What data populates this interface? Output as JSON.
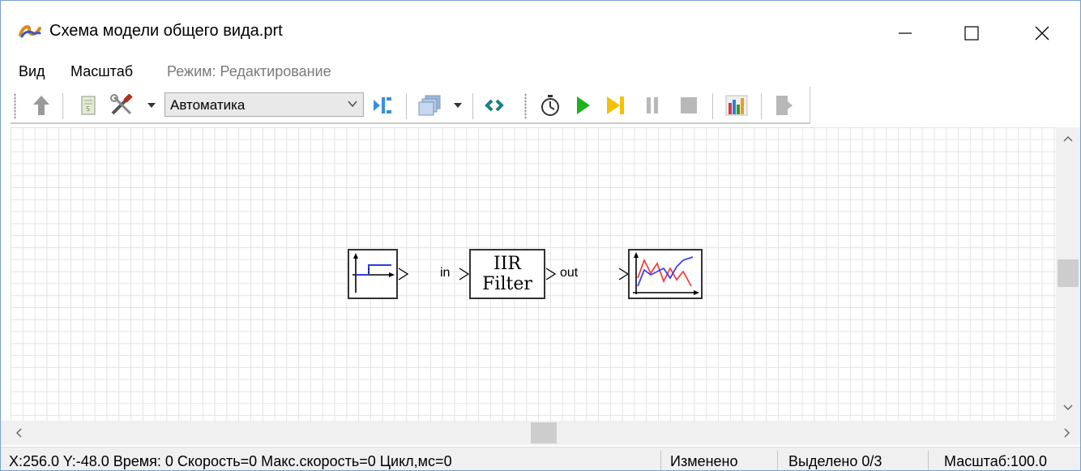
{
  "window": {
    "title": "Схема модели общего вида.prt"
  },
  "menu": {
    "items": [
      "Вид",
      "Масштаб"
    ],
    "mode_label": "Режим: Редактирование"
  },
  "toolbar": {
    "library_combo_value": "Автоматика",
    "icons": [
      "up-arrow-icon",
      "script-icon",
      "tools-icon",
      "dropdown-arrow-icon",
      "library-combo",
      "block-library-icon",
      "layers-icon",
      "dropdown-arrow-icon",
      "refresh-icon",
      "stopwatch-icon",
      "play-icon",
      "step-icon",
      "pause-icon",
      "stop-icon",
      "bar-chart-icon",
      "exit-icon"
    ],
    "colors": {
      "play": "#1db31d",
      "step": "#f2c200",
      "disabled": "#b8b8b8"
    }
  },
  "diagram": {
    "blocks": [
      {
        "name": "step-source-block"
      },
      {
        "name": "iir-filter-block",
        "line1": "IIR",
        "line2": "Filter"
      },
      {
        "name": "plot-block"
      }
    ],
    "filter_input_label": "in",
    "filter_output_label": "out",
    "colors": {
      "plot_red": "#f04040",
      "plot_blue": "#4040f0",
      "step_blue": "#2f3fd0"
    }
  },
  "statusbar": {
    "info": "X:256.0  Y:-48.0 Время: 0 Скорость=0 Макс.скорость=0 Цикл,мс=0",
    "modified": "Изменено",
    "selected": "Выделено 0/3",
    "scale": "Масштаб:100.0"
  }
}
